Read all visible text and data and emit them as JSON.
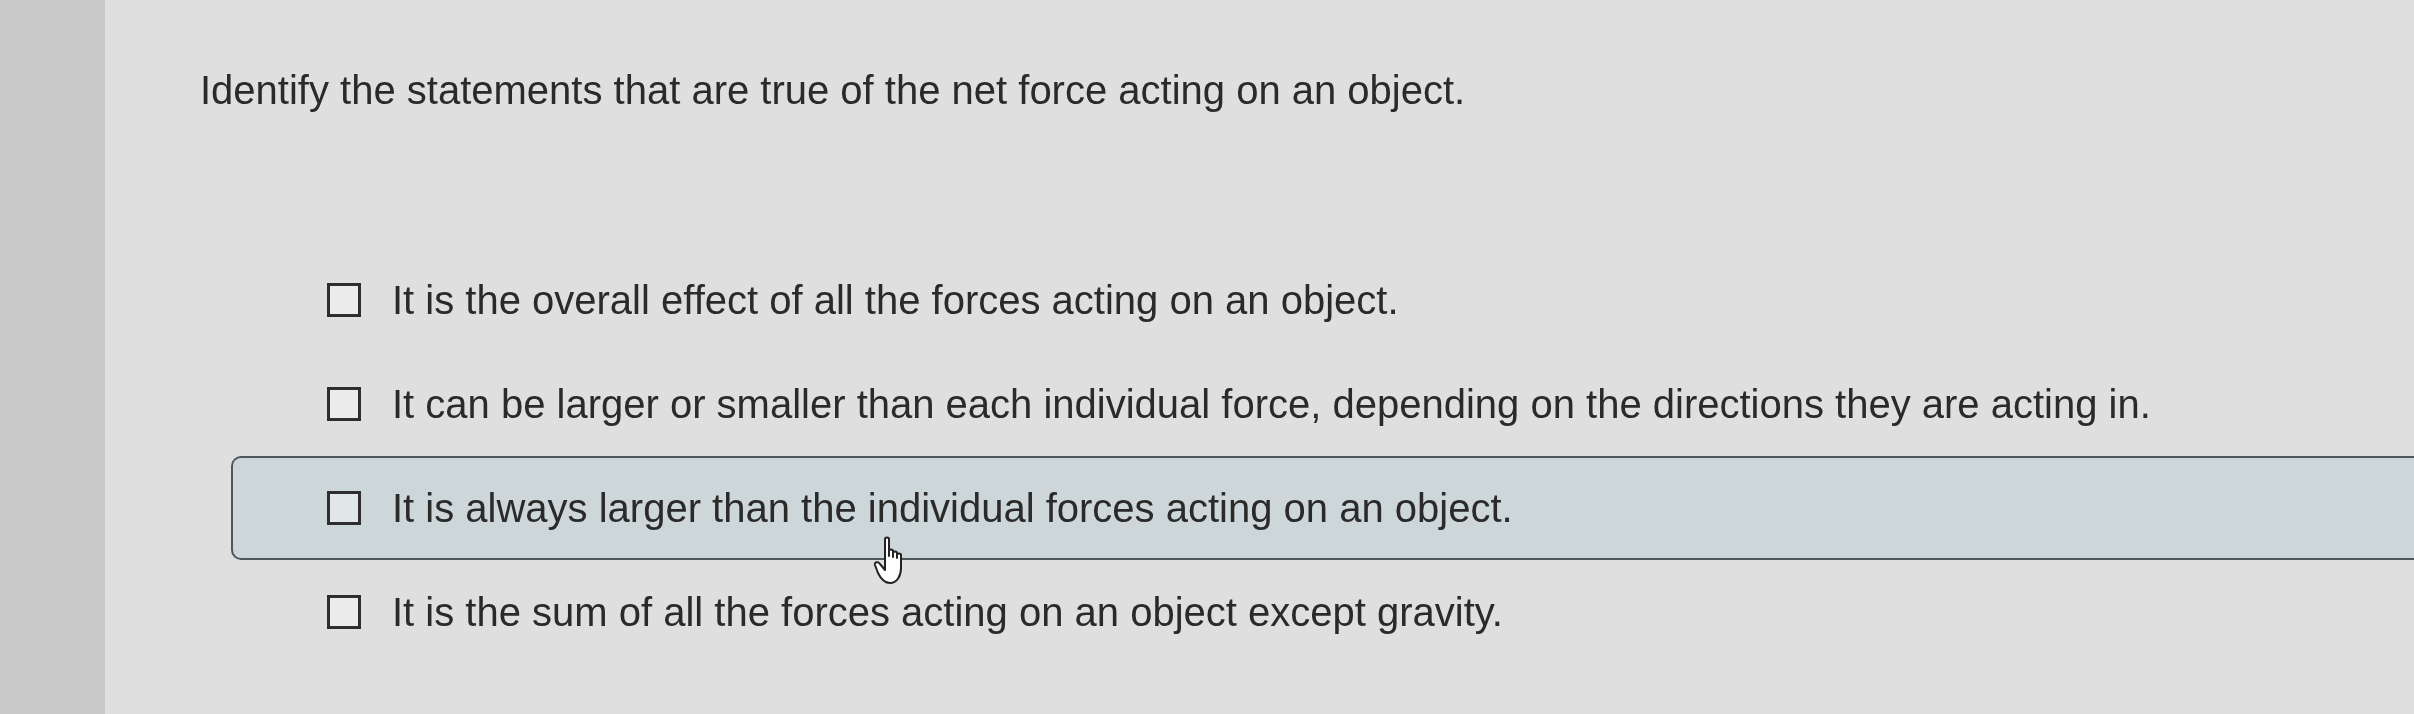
{
  "question": "Identify the statements that are true of the net force acting on an object.",
  "options": [
    {
      "text": "It is the overall effect of all the forces acting on an object.",
      "checked": false,
      "hovered": false
    },
    {
      "text": "It can be larger or smaller than each individual force, depending on the directions they are acting in.",
      "checked": false,
      "hovered": false
    },
    {
      "text": "It is always larger than the individual forces acting on an object.",
      "checked": false,
      "hovered": true
    },
    {
      "text": "It is the sum of all the forces acting on an object except gravity.",
      "checked": false,
      "hovered": false
    }
  ]
}
